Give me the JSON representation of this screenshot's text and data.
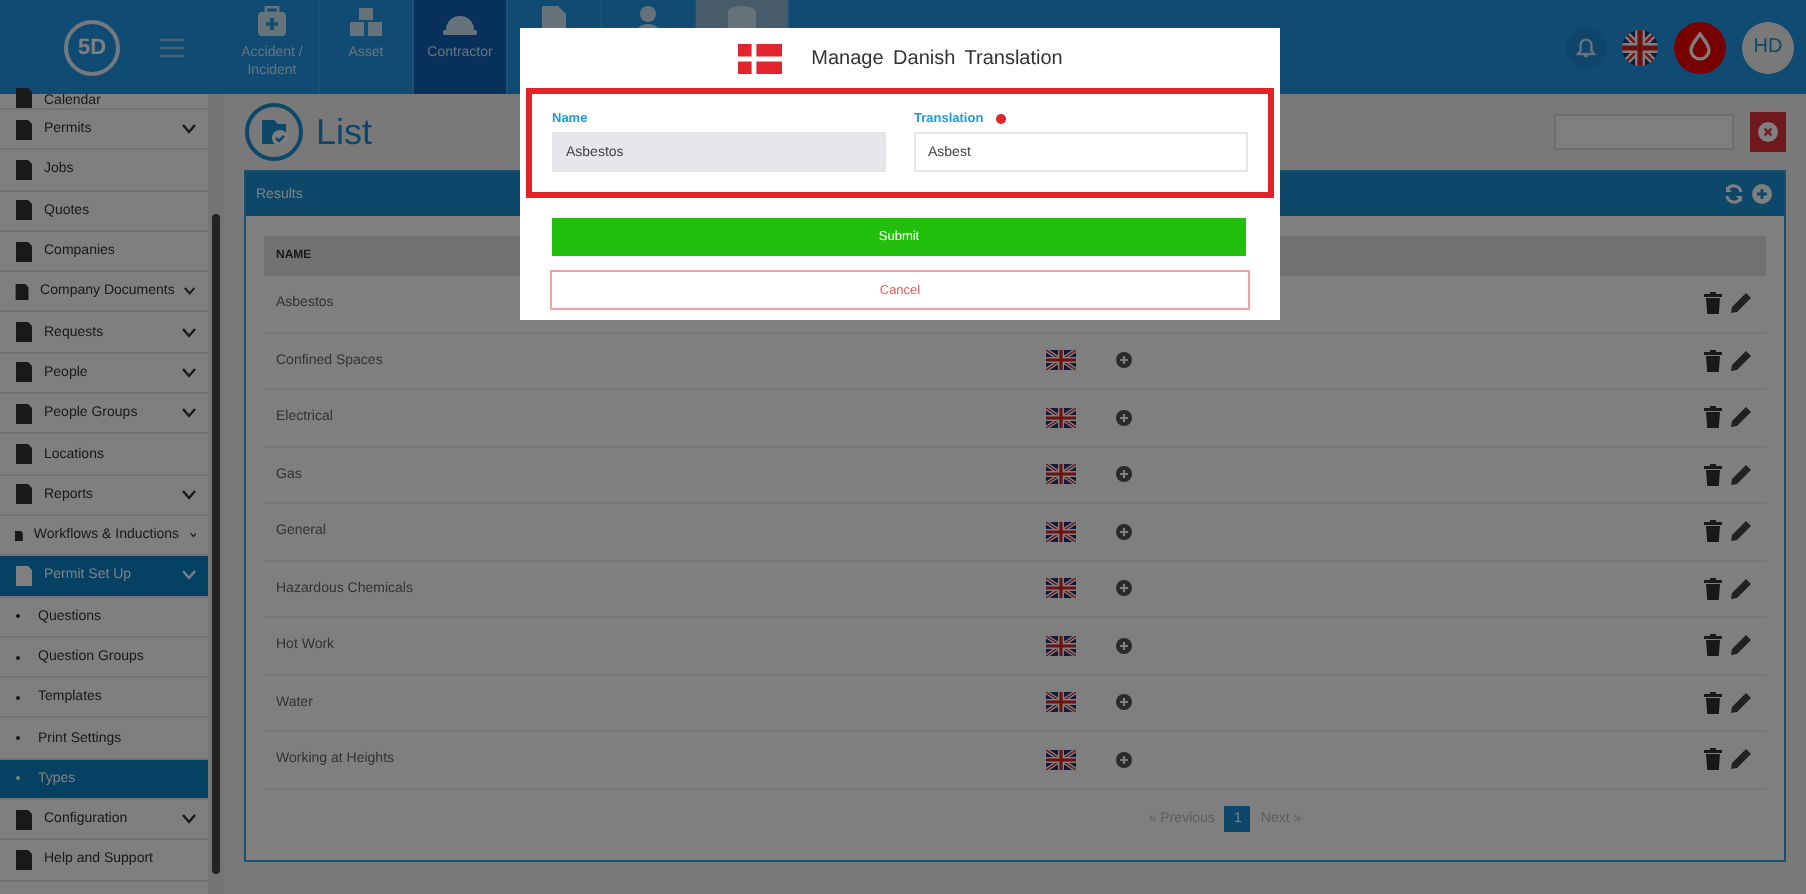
{
  "header": {
    "logo": "5D",
    "nav": [
      {
        "label": "Accident / Incident",
        "selected": false,
        "highlighted": false
      },
      {
        "label": "Asset",
        "selected": false,
        "highlighted": false
      },
      {
        "label": "Contractor",
        "selected": true,
        "highlighted": false
      },
      {
        "selected": false,
        "highlighted": false
      },
      {
        "selected": false,
        "highlighted": false
      },
      {
        "selected": false,
        "highlighted": true
      }
    ],
    "avatar": "HD"
  },
  "sidebar": {
    "items": [
      {
        "label": "Calendar",
        "kind": "menu",
        "expandable": false,
        "selected": false
      },
      {
        "label": "Permits",
        "kind": "menu",
        "expandable": true,
        "selected": false
      },
      {
        "label": "Jobs",
        "kind": "menu",
        "expandable": false,
        "selected": false
      },
      {
        "label": "Quotes",
        "kind": "menu",
        "expandable": false,
        "selected": false
      },
      {
        "label": "Companies",
        "kind": "menu",
        "expandable": false,
        "selected": false
      },
      {
        "label": "Company Documents",
        "kind": "menu",
        "expandable": true,
        "selected": false
      },
      {
        "label": "Requests",
        "kind": "menu",
        "expandable": true,
        "selected": false
      },
      {
        "label": "People",
        "kind": "menu",
        "expandable": true,
        "selected": false
      },
      {
        "label": "People Groups",
        "kind": "menu",
        "expandable": true,
        "selected": false
      },
      {
        "label": "Locations",
        "kind": "menu",
        "expandable": false,
        "selected": false
      },
      {
        "label": "Reports",
        "kind": "menu",
        "expandable": true,
        "selected": false
      },
      {
        "label": "Workflows & Inductions",
        "kind": "menu",
        "expandable": true,
        "selected": false
      },
      {
        "label": "Permit Set Up",
        "kind": "menu",
        "expandable": true,
        "selected": true
      },
      {
        "label": "Questions",
        "kind": "sub",
        "expandable": false,
        "selected": false
      },
      {
        "label": "Question Groups",
        "kind": "sub",
        "expandable": false,
        "selected": false
      },
      {
        "label": "Templates",
        "kind": "sub",
        "expandable": false,
        "selected": false
      },
      {
        "label": "Print Settings",
        "kind": "sub",
        "expandable": false,
        "selected": false
      },
      {
        "label": "Types",
        "kind": "sub",
        "expandable": false,
        "selected": true
      },
      {
        "label": "Configuration",
        "kind": "menu",
        "expandable": true,
        "selected": false
      },
      {
        "label": "Help and Support",
        "kind": "menu",
        "expandable": false,
        "selected": false
      }
    ]
  },
  "page": {
    "title": "List"
  },
  "results": {
    "title": "Results",
    "columns": [
      "NAME"
    ],
    "rows": [
      {
        "name": "Asbestos",
        "kind": "plain"
      },
      {
        "name": "Confined Spaces",
        "kind": "flagged"
      },
      {
        "name": "Electrical",
        "kind": "flagged"
      },
      {
        "name": "Gas",
        "kind": "flagged"
      },
      {
        "name": "General",
        "kind": "flagged"
      },
      {
        "name": "Hazardous Chemicals",
        "kind": "flagged"
      },
      {
        "name": "Hot Work",
        "kind": "flagged"
      },
      {
        "name": "Water",
        "kind": "flagged"
      },
      {
        "name": "Working at Heights",
        "kind": "flagged"
      }
    ],
    "pagination": {
      "previous": "« Previous",
      "pages": [
        {
          "label": "1",
          "selected": true
        }
      ],
      "next": "Next »"
    }
  },
  "modal": {
    "title": "Manage Danish Translation",
    "name_field": {
      "label": "Name",
      "value": "Asbestos"
    },
    "translation_field": {
      "label": "Translation",
      "required": true,
      "value": "Asbest"
    },
    "submit": "Submit",
    "cancel": "Cancel"
  }
}
